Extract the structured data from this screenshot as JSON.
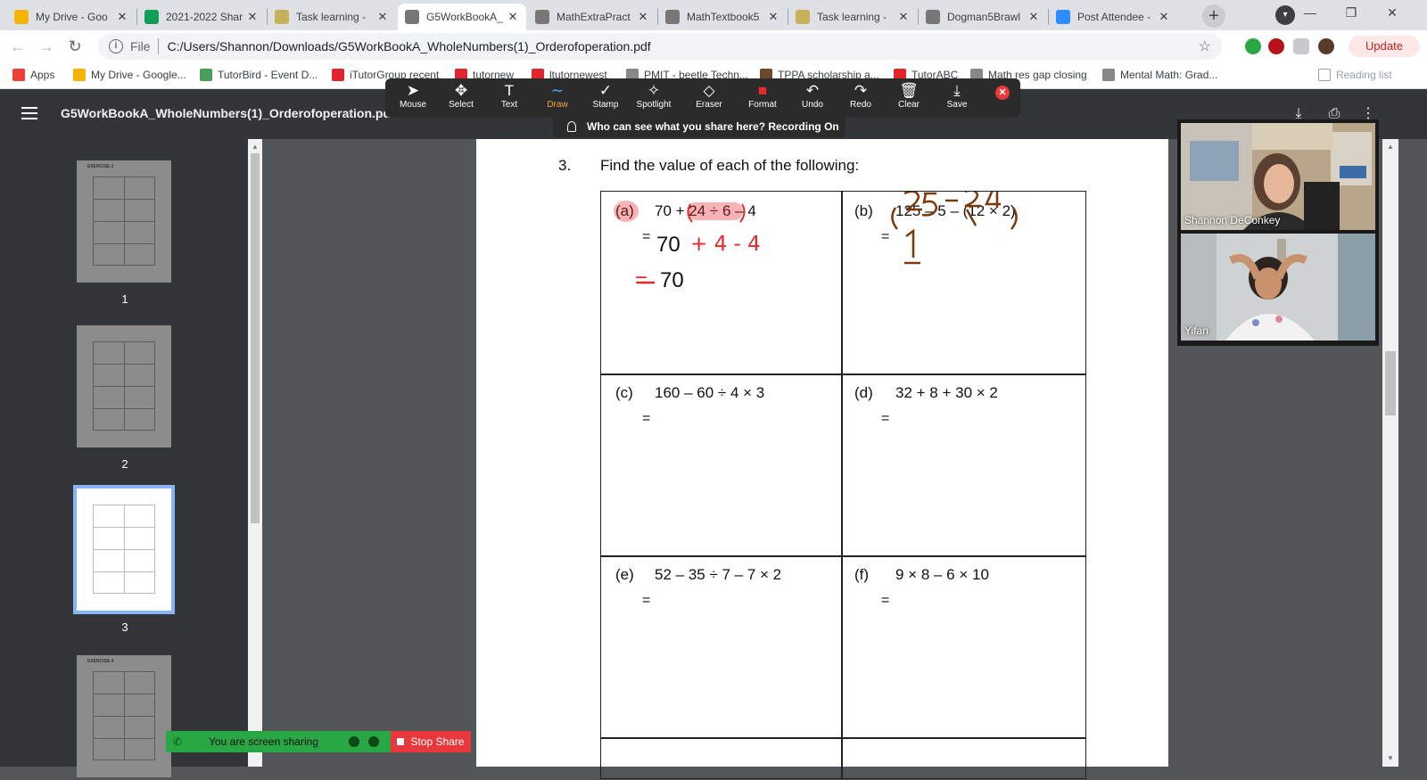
{
  "browser": {
    "tabs": [
      {
        "label": "My Drive - Goo",
        "icon": "google-drive-icon",
        "color": "#f4b400"
      },
      {
        "label": "2021-2022 Shar",
        "icon": "sheets-icon",
        "color": "#0f9d58"
      },
      {
        "label": "Task learning - ",
        "icon": "task-icon",
        "color": "#c8b15a"
      },
      {
        "label": "G5WorkBookA_",
        "icon": "globe-icon",
        "color": "#777777"
      },
      {
        "label": "MathExtraPract",
        "icon": "globe-icon",
        "color": "#777777"
      },
      {
        "label": "MathTextbook5",
        "icon": "globe-icon",
        "color": "#777777"
      },
      {
        "label": "Task learning - ",
        "icon": "task-icon",
        "color": "#c8b15a"
      },
      {
        "label": "Dogman5Brawl",
        "icon": "globe-icon",
        "color": "#777777"
      },
      {
        "label": "Post Attendee -",
        "icon": "zoom-icon",
        "color": "#2d8cff"
      }
    ],
    "active_tab_index": 3,
    "close_glyph": "✕",
    "new_tab_glyph": "+",
    "address": {
      "scheme": "File",
      "url": "C:/Users/Shannon/Downloads/G5WorkBookA_WholeNumbers(1)_Orderofoperation.pdf"
    },
    "update_label": "Update",
    "bookmarks": [
      {
        "label": "Apps",
        "icon": "apps-grid-icon",
        "color": "#ea4335"
      },
      {
        "label": "My Drive - Google...",
        "icon": "google-drive-icon",
        "color": "#f4b400"
      },
      {
        "label": "TutorBird - Event D...",
        "icon": "tutorbird-icon",
        "color": "#4a9d5a"
      },
      {
        "label": "iTutorGroup recent",
        "icon": "itutor-icon",
        "color": "#e0262b"
      },
      {
        "label": "tutornew",
        "icon": "itutor-icon",
        "color": "#e0262b"
      },
      {
        "label": "ltutornewest",
        "icon": "itutor-icon",
        "color": "#e0262b"
      },
      {
        "label": "PMIT - beetle Techn...",
        "icon": "globe-icon",
        "color": "#888888"
      },
      {
        "label": "TPPA scholarship a...",
        "icon": "tppa-icon",
        "color": "#6a4a2a"
      },
      {
        "label": "TutorABC",
        "icon": "itutor-icon",
        "color": "#e0262b"
      },
      {
        "label": "Math res gap closing",
        "icon": "globe-icon",
        "color": "#888888"
      },
      {
        "label": "Mental Math: Grad...",
        "icon": "globe-icon",
        "color": "#888888"
      }
    ],
    "reading_list_label": "Reading list"
  },
  "pdf": {
    "title": "G5WorkBookA_WholeNumbers(1)_Orderofoperation.pdf",
    "thumbnails": [
      {
        "page": "1",
        "heading": "EXERCISE 1"
      },
      {
        "page": "2",
        "heading": ""
      },
      {
        "page": "3",
        "heading": ""
      },
      {
        "page": "",
        "heading": "EXERCISE 4"
      }
    ],
    "selected_page_index": 2
  },
  "zoom_tools": {
    "items": [
      {
        "label": "Mouse",
        "glyph": "➤",
        "name": "mouse-tool"
      },
      {
        "label": "Select",
        "glyph": "✥",
        "name": "select-tool"
      },
      {
        "label": "Text",
        "glyph": "T",
        "name": "text-tool"
      },
      {
        "label": "Draw",
        "glyph": "∼",
        "name": "draw-tool"
      },
      {
        "label": "Stamp",
        "glyph": "✓",
        "name": "stamp-tool"
      },
      {
        "label": "Spotlight",
        "glyph": "✧",
        "name": "spotlight-tool"
      },
      {
        "label": "Eraser",
        "glyph": "◇",
        "name": "eraser-tool"
      },
      {
        "label": "Format",
        "glyph": "■",
        "name": "format-tool"
      },
      {
        "label": "Undo",
        "glyph": "↶",
        "name": "undo-tool"
      },
      {
        "label": "Redo",
        "glyph": "↷",
        "name": "redo-tool"
      },
      {
        "label": "Clear",
        "glyph": "🗑",
        "name": "clear-tool"
      },
      {
        "label": "Save",
        "glyph": "⤓",
        "name": "save-tool"
      }
    ],
    "active_index": 3,
    "active_color": "#f0a93a",
    "format_color": "#e8262b",
    "close_glyph": "✕",
    "share_notice": "Who can see what you share here? Recording On"
  },
  "worksheet": {
    "question_number": "3.",
    "question_text": "Find the value of each of the following:",
    "cells": [
      {
        "label": "(a)",
        "expression": "70 + 24 ÷ 6 – 4",
        "equals": "="
      },
      {
        "label": "(b)",
        "expression": "125 – 5 – (12 × 2)",
        "equals": "="
      },
      {
        "label": "(c)",
        "expression": "160 – 60 ÷ 4 × 3",
        "equals": "="
      },
      {
        "label": "(d)",
        "expression": "32 + 8 + 30 × 2",
        "equals": "="
      },
      {
        "label": "(e)",
        "expression": "52 – 35 ÷ 7 – 7 × 2",
        "equals": "="
      },
      {
        "label": "(f)",
        "expression": "9 × 8 – 6 × 10",
        "equals": "="
      }
    ],
    "work_a_line1": "70",
    "work_a_line1_annot": "+ 4 - 4",
    "work_a_line2_eq": "=",
    "work_a_line2": "70",
    "annotation_colors": {
      "red": "#e8262b",
      "brown": "#7a3b0c"
    }
  },
  "participants": [
    {
      "name": "Shannon DeConkey"
    },
    {
      "name": "Yifan"
    }
  ],
  "share_bar": {
    "status": "You are screen sharing",
    "stop_label": "Stop Share",
    "stop_color": "#e8383b",
    "bar_color": "#2aa745"
  }
}
